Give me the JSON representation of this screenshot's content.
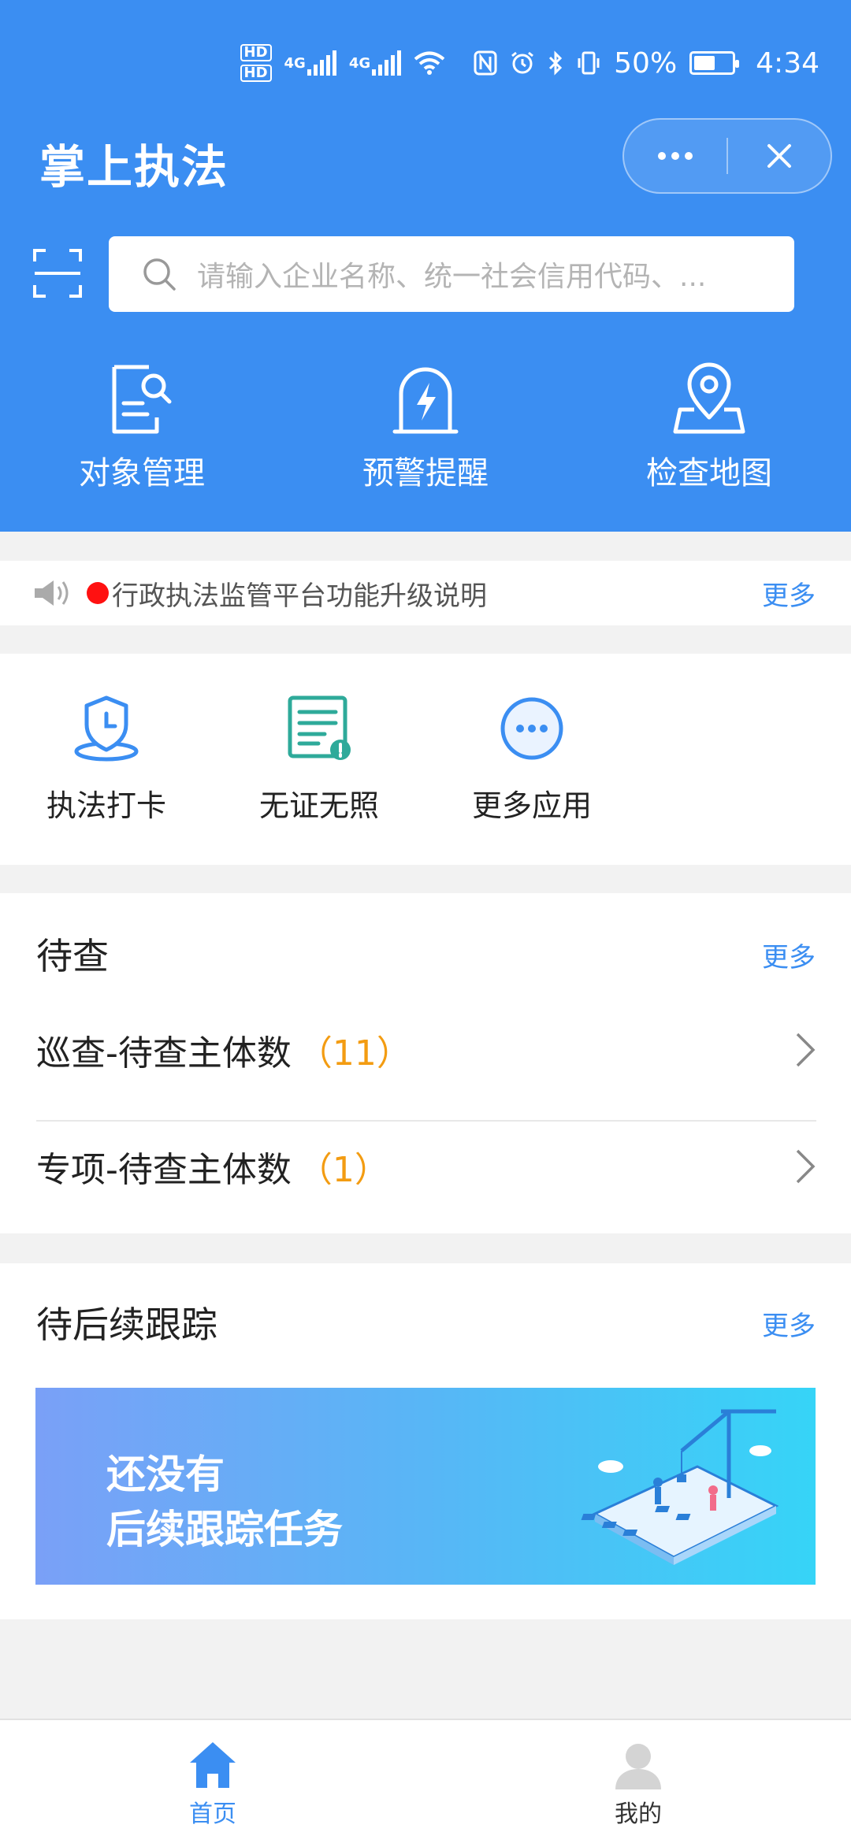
{
  "status_bar": {
    "hd1": "HD",
    "hd2": "HD",
    "net1": "4G",
    "net2": "4G",
    "battery_percent": "50%",
    "time": "4:34"
  },
  "header": {
    "title": "掌上执法",
    "search_placeholder": "请输入企业名称、统一社会信用代码、..."
  },
  "quick_actions": [
    {
      "label": "对象管理",
      "icon": "document-search-icon"
    },
    {
      "label": "预警提醒",
      "icon": "warning-bolt-icon"
    },
    {
      "label": "检查地图",
      "icon": "map-pin-icon"
    }
  ],
  "notice": {
    "text": "行政执法监管平台功能升级说明",
    "more": "更多"
  },
  "apps": [
    {
      "label": "执法打卡",
      "icon": "shield-clock-icon"
    },
    {
      "label": "无证无照",
      "icon": "license-alert-icon"
    },
    {
      "label": "更多应用",
      "icon": "more-circle-icon"
    }
  ],
  "pending": {
    "title": "待查",
    "more": "更多",
    "rows": [
      {
        "label": "巡查-待查主体数",
        "count": "（11）"
      },
      {
        "label": "专项-待查主体数",
        "count": "（1）"
      }
    ]
  },
  "follow_up": {
    "title": "待后续跟踪",
    "more": "更多",
    "empty_line1": "还没有",
    "empty_line2": "后续跟踪任务"
  },
  "tabbar": {
    "home": "首页",
    "mine": "我的"
  },
  "colors": {
    "primary": "#3b8ef2",
    "accent_count": "#f39c12",
    "notice_dot": "#ff1111"
  }
}
